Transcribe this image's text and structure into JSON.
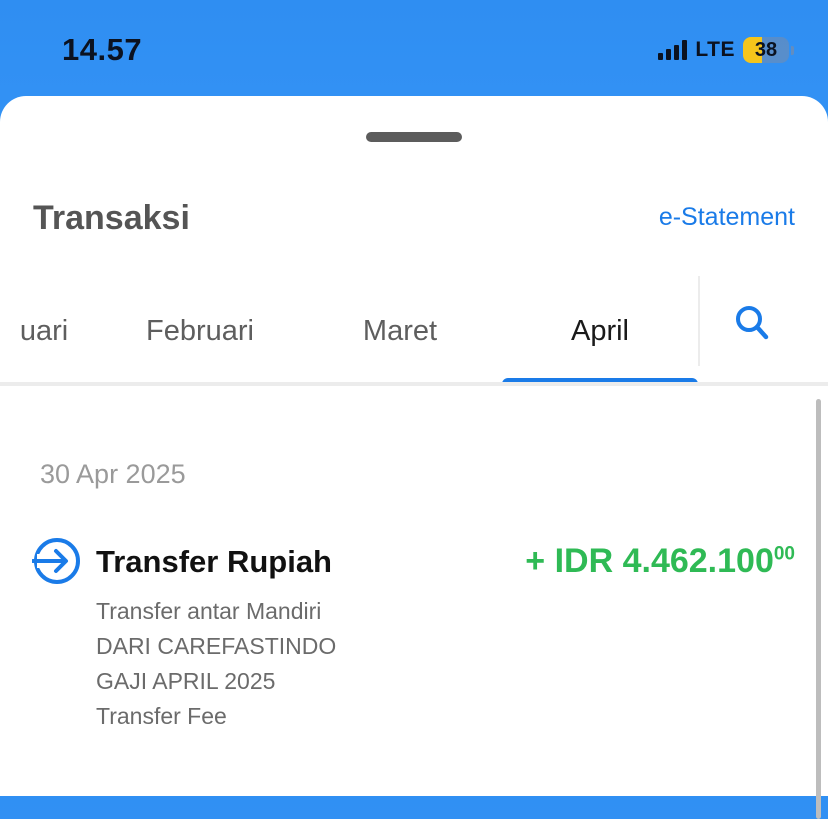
{
  "status_bar": {
    "time": "14.57",
    "network": "LTE",
    "battery": "38"
  },
  "header": {
    "title": "Transaksi",
    "estatement_link": "e-Statement"
  },
  "tabs": [
    {
      "label": "uari"
    },
    {
      "label": "Februari"
    },
    {
      "label": "Maret"
    },
    {
      "label": "April",
      "active": true
    }
  ],
  "transactions": {
    "date": "30 Apr 2025",
    "item": {
      "title": "Transfer Rupiah",
      "amount_main": "+ IDR 4.462.100",
      "amount_cents": "00",
      "details": [
        "Transfer antar Mandiri",
        "DARI CAREFASTINDO",
        "GAJI APRIL 2025",
        "Transfer Fee"
      ]
    }
  },
  "colors": {
    "accent": "#1a7be8",
    "credit": "#2fba55",
    "header_bg": "#2f8ef2"
  },
  "icons": [
    "search-icon",
    "transfer-in-icon",
    "signal-icon",
    "battery-icon"
  ]
}
